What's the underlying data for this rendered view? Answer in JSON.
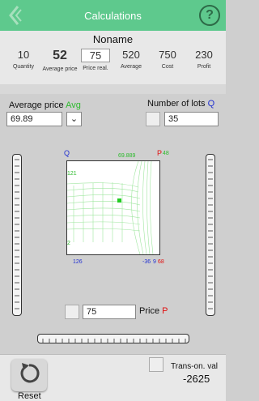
{
  "header": {
    "title": "Calculations",
    "help": "?"
  },
  "product": {
    "name": "Noname"
  },
  "stats": [
    {
      "value": "10",
      "label": "Quantity"
    },
    {
      "value": "52",
      "label": "Average price"
    },
    {
      "value": "75",
      "label": "Price real."
    },
    {
      "value": "520",
      "label": "Average"
    },
    {
      "value": "750",
      "label": "Cost"
    },
    {
      "value": "230",
      "label": "Profit"
    }
  ],
  "avg": {
    "label": "Average price",
    "tag": "Avg",
    "value": "69.89",
    "dropdown": "⌄"
  },
  "lots": {
    "label": "Number of lots",
    "tag": "Q",
    "value": "35"
  },
  "plot": {
    "q": "Q",
    "top_val": "69.889",
    "p_tag": "P",
    "p_val": "48",
    "left_val": "121",
    "left_low": "2",
    "bottom_left": "126",
    "bottom_mid": "-36",
    "bottom_num": "9",
    "bottom_red": "68"
  },
  "price": {
    "label": "Price",
    "tag": "P",
    "value": "75"
  },
  "bottom": {
    "reset": "Reset",
    "trans_label": "Trans-on. val",
    "trans_value": "-2625"
  },
  "colors": {
    "header": "#5ec98d",
    "plot_lines": "#8be08b"
  }
}
